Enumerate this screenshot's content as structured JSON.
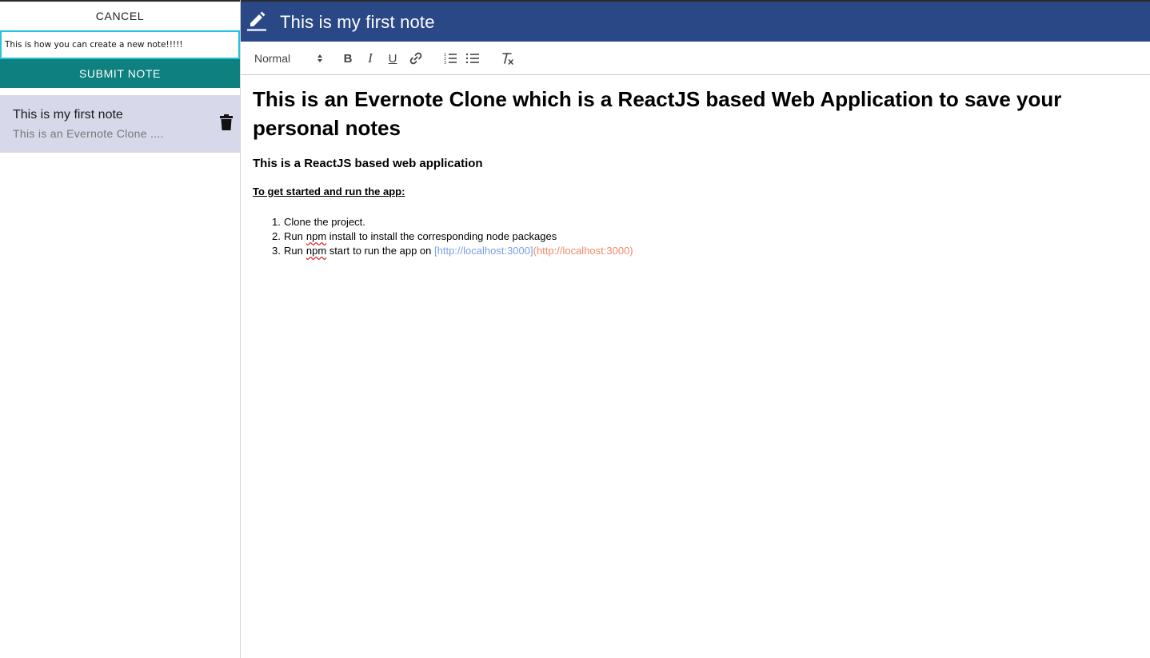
{
  "sidebar": {
    "cancel_label": "CANCEL",
    "new_note_value": "This is how you can create a new note!!!!!",
    "submit_label": "SUBMIT NOTE",
    "notes": [
      {
        "title": "This is my first note",
        "preview": "This is an Evernote Clone ...."
      }
    ]
  },
  "header": {
    "title": "This is my first note",
    "edit_icon": "pencil-icon"
  },
  "toolbar": {
    "format_value": "Normal",
    "bold_label": "B",
    "italic_label": "I",
    "underline_label": "U",
    "icons": [
      "link-icon",
      "ordered-list-icon",
      "bullet-list-icon",
      "clear-format-icon"
    ]
  },
  "document": {
    "heading": "This is an Evernote Clone which is a ReactJS based Web Application to save your personal notes",
    "subheading": "This is a ReactJS based web application",
    "instructions_title": "To get started and run the app:",
    "steps": [
      {
        "num": "1.",
        "text": "Clone the project."
      },
      {
        "num": "2.",
        "prefix": "Run",
        "code": "npm",
        "code_rest": "install",
        "suffix": "to install the corresponding node packages"
      },
      {
        "num": "3.",
        "prefix": "Run",
        "code": "npm",
        "code_rest": "start",
        "suffix": "to run the app on",
        "link_text": "[http://localhost:3000]",
        "link_url": "(http://localhost:3000)"
      }
    ]
  },
  "colors": {
    "header_bg": "#2a4886",
    "submit_bg": "#0e8080",
    "selected_note_bg": "#d7d9eb",
    "input_border": "#22c5d9",
    "link_text": "#7a9fe6",
    "link_url": "#ef8a6a"
  }
}
